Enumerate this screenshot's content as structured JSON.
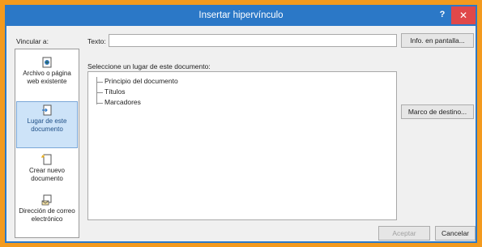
{
  "dialog": {
    "title": "Insertar hipervínculo",
    "help_label": "?",
    "close_label": "✕"
  },
  "form": {
    "link_to_label": "Vincular a:",
    "text_label": "Texto:",
    "text_value": "",
    "screentip_button": "Info. en pantalla...",
    "place_label": "Seleccione un lugar de este documento:",
    "bookmark_button": "Marco de destino...",
    "accept_button": "Aceptar",
    "cancel_button": "Cancelar"
  },
  "sidebar": {
    "items": [
      {
        "label": "Archivo o página web existente",
        "icon": "existing-file-web-page-icon",
        "active": false
      },
      {
        "label": "Lugar de este documento",
        "icon": "place-in-document-icon",
        "active": true
      },
      {
        "label": "Crear nuevo documento",
        "icon": "new-document-icon",
        "active": false
      },
      {
        "label": "Dirección de correo electrónico",
        "icon": "email-address-icon",
        "active": false
      }
    ]
  },
  "tree": {
    "nodes": [
      "Principio del documento",
      "Títulos",
      "Marcadores"
    ]
  }
}
